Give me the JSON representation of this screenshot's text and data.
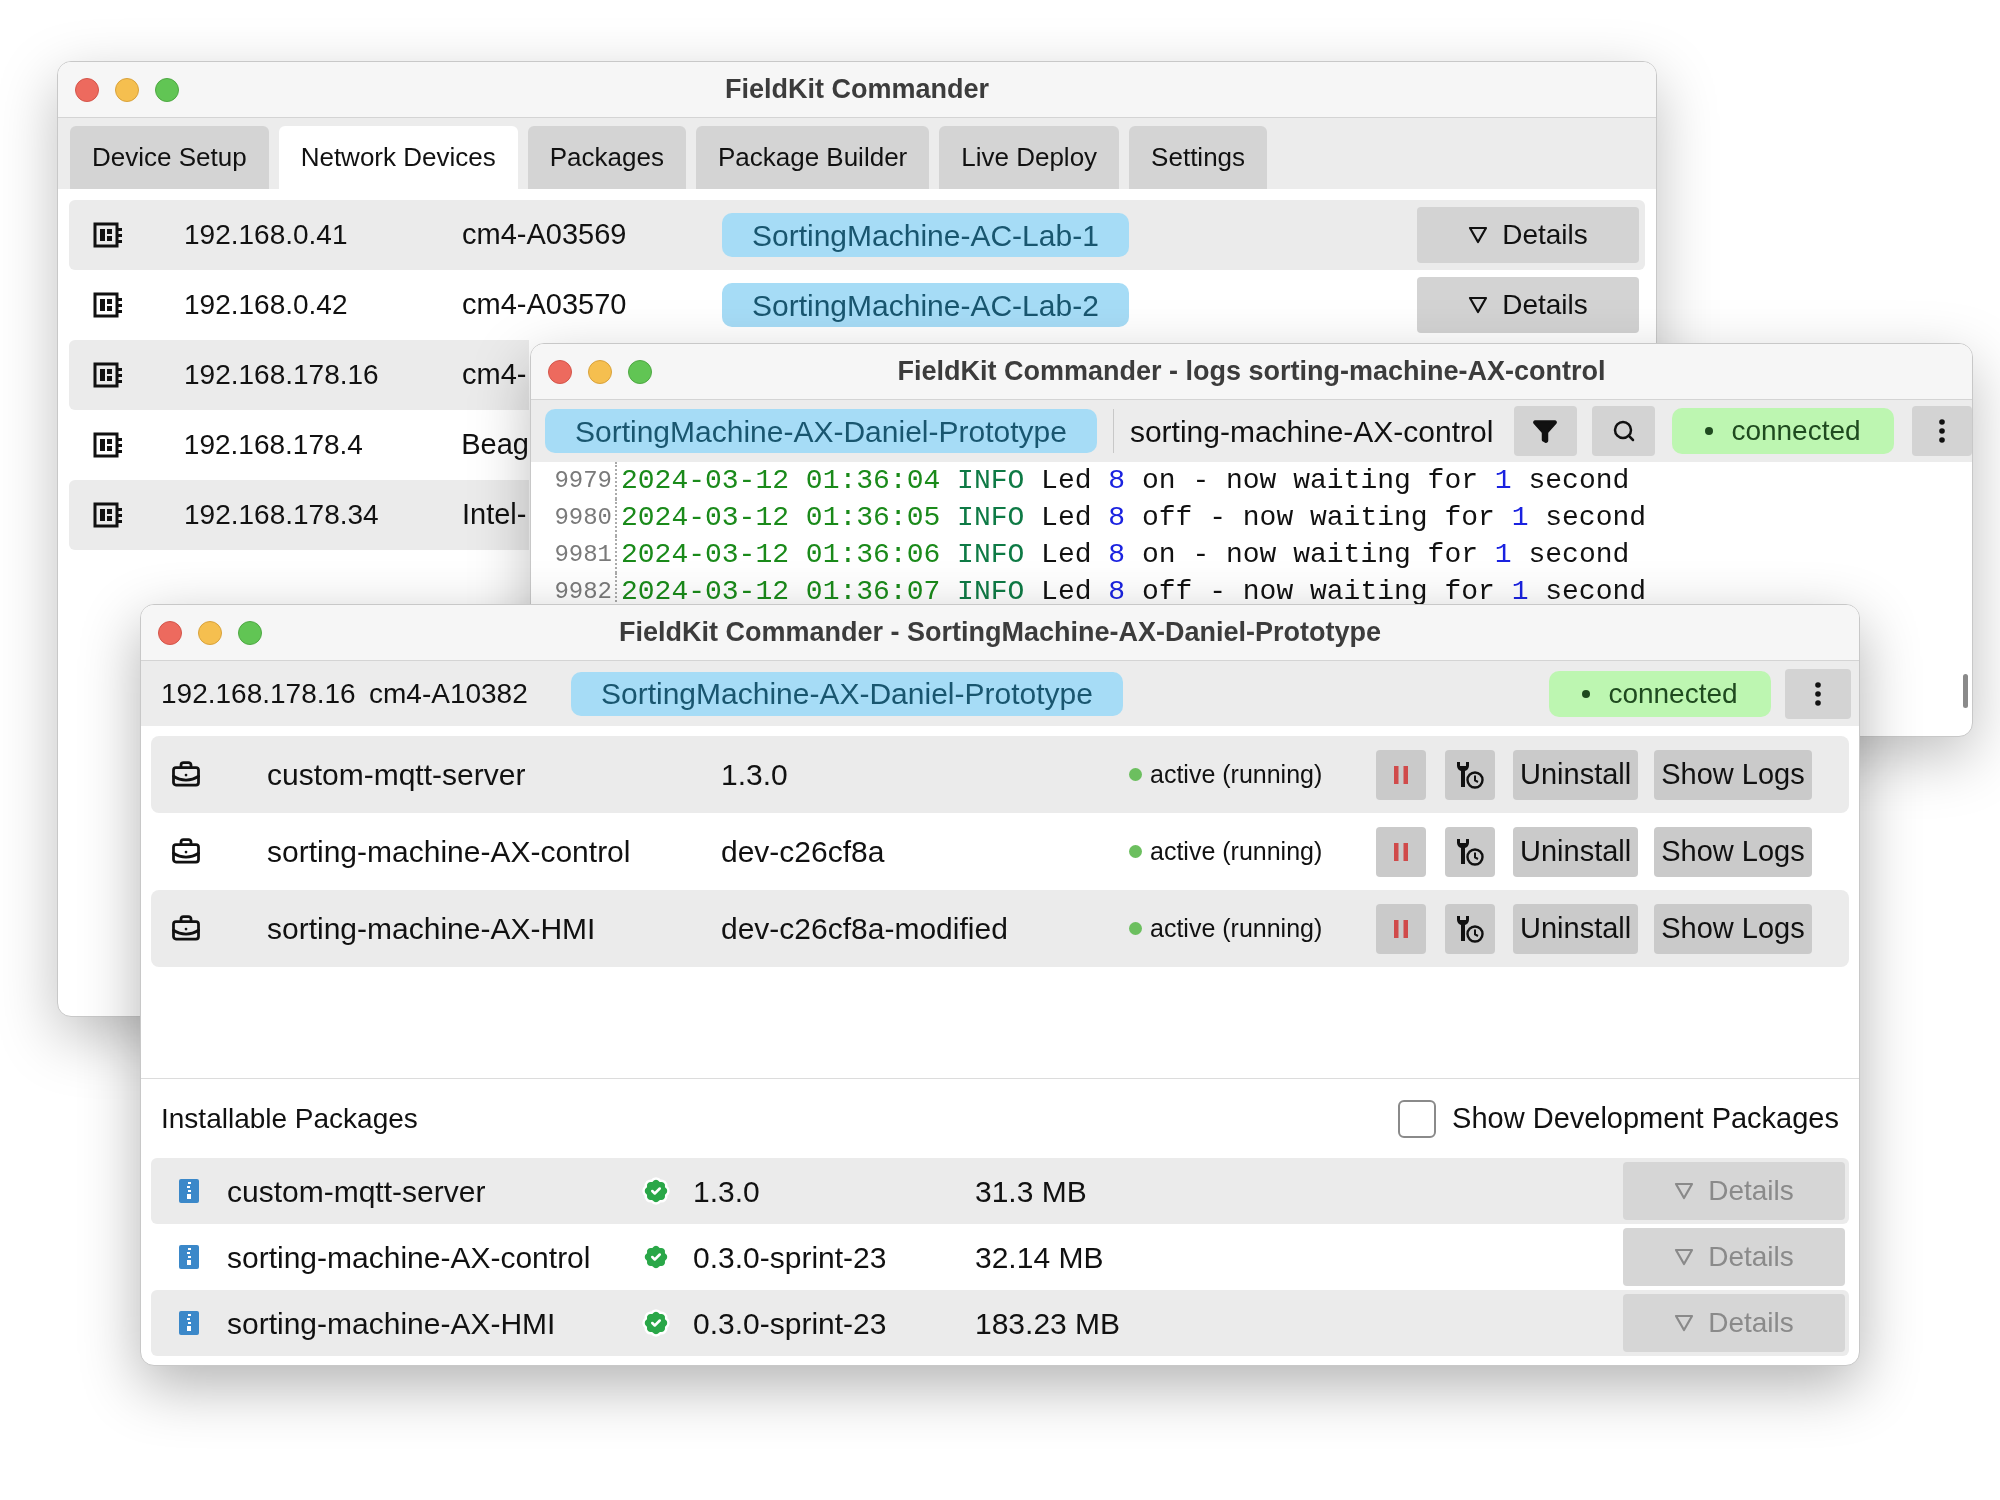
{
  "devices_window": {
    "title": "FieldKit Commander",
    "tabs": [
      {
        "label": "Device Setup",
        "selected": false
      },
      {
        "label": "Network Devices",
        "selected": true
      },
      {
        "label": "Packages",
        "selected": false
      },
      {
        "label": "Package Builder",
        "selected": false
      },
      {
        "label": "Live Deploy",
        "selected": false
      },
      {
        "label": "Settings",
        "selected": false
      }
    ],
    "devices": [
      {
        "ip": "192.168.0.41",
        "hostname": "cm4-A03569",
        "name": "SortingMachine-AC-Lab-1",
        "details": "Details"
      },
      {
        "ip": "192.168.0.42",
        "hostname": "cm4-A03570",
        "name": "SortingMachine-AC-Lab-2",
        "details": "Details"
      },
      {
        "ip": "192.168.178.16",
        "hostname": "cm4-"
      },
      {
        "ip": "192.168.178.4",
        "hostname": "Beag"
      },
      {
        "ip": "192.168.178.34",
        "hostname": "Intel-"
      }
    ]
  },
  "logs_window": {
    "title": "FieldKit Commander - logs sorting-machine-AX-control",
    "device": "SortingMachine-AX-Daniel-Prototype",
    "package": "sorting-machine-AX-control",
    "status": "connected",
    "connected": true,
    "lines": [
      {
        "number": "9979",
        "timestamp": "2024-03-12 01:36:04",
        "level": "INFO",
        "message": [
          {
            "kind": "text",
            "text": "Led"
          },
          {
            "kind": "number",
            "text": "8"
          },
          {
            "kind": "text",
            "text": "on - now waiting for"
          },
          {
            "kind": "number",
            "text": "1"
          },
          {
            "kind": "text",
            "text": "second"
          }
        ]
      },
      {
        "number": "9980",
        "timestamp": "2024-03-12 01:36:05",
        "level": "INFO",
        "message": [
          {
            "kind": "text",
            "text": "Led"
          },
          {
            "kind": "number",
            "text": "8"
          },
          {
            "kind": "text",
            "text": "off - now waiting for"
          },
          {
            "kind": "number",
            "text": "1"
          },
          {
            "kind": "text",
            "text": "second"
          }
        ]
      },
      {
        "number": "9981",
        "timestamp": "2024-03-12 01:36:06",
        "level": "INFO",
        "message": [
          {
            "kind": "text",
            "text": "Led"
          },
          {
            "kind": "number",
            "text": "8"
          },
          {
            "kind": "text",
            "text": "on - now waiting for"
          },
          {
            "kind": "number",
            "text": "1"
          },
          {
            "kind": "text",
            "text": "second"
          }
        ]
      },
      {
        "number": "9982",
        "timestamp": "2024-03-12 01:36:07",
        "level": "INFO",
        "message": [
          {
            "kind": "text",
            "text": "Led"
          },
          {
            "kind": "number",
            "text": "8"
          },
          {
            "kind": "text",
            "text": "off - now waiting for"
          },
          {
            "kind": "number",
            "text": "1"
          },
          {
            "kind": "text",
            "text": "second"
          }
        ]
      }
    ]
  },
  "device_window": {
    "title": "FieldKit Commander - SortingMachine-AX-Daniel-Prototype",
    "ip": "192.168.178.16",
    "hostname": "cm4-A10382",
    "name": "SortingMachine-AX-Daniel-Prototype",
    "status": "connected",
    "connected": true,
    "services": [
      {
        "name": "custom-mqtt-server",
        "version": "1.3.0",
        "status": "active (running)",
        "running": true,
        "buttons": [
          "Uninstall",
          "Show Logs"
        ]
      },
      {
        "name": "sorting-machine-AX-control",
        "version": "dev-c26cf8a",
        "status": "active (running)",
        "running": true,
        "buttons": [
          "Uninstall",
          "Show Logs"
        ]
      },
      {
        "name": "sorting-machine-AX-HMI",
        "version": "dev-c26cf8a-modified",
        "status": "active (running)",
        "running": true,
        "buttons": [
          "Uninstall",
          "Show Logs"
        ]
      }
    ],
    "installable": {
      "title": "Installable Packages",
      "show_dev": {
        "label": "Show Development Packages",
        "checked": false
      },
      "packages": [
        {
          "name": "custom-mqtt-server",
          "verified": true,
          "version": "1.3.0",
          "size": "31.3 MB",
          "details": "Details",
          "disabled": true
        },
        {
          "name": "sorting-machine-AX-control",
          "verified": true,
          "version": "0.3.0-sprint-23",
          "size": "32.14 MB",
          "details": "Details",
          "disabled": true
        },
        {
          "name": "sorting-machine-AX-HMI",
          "verified": true,
          "version": "0.3.0-sprint-23",
          "size": "183.23 MB",
          "details": "Details",
          "disabled": true
        }
      ]
    }
  }
}
